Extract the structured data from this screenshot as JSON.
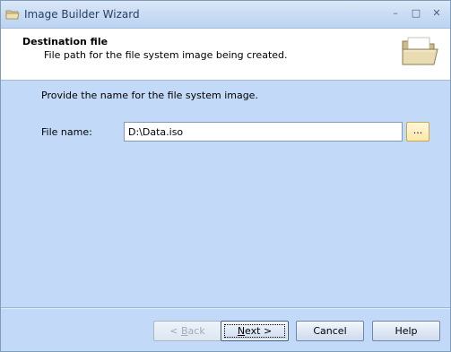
{
  "window": {
    "title": "Image Builder Wizard",
    "controls": {
      "minimize": "–",
      "restore": "□",
      "close": "✕"
    }
  },
  "header": {
    "title": "Destination file",
    "subtitle": "File path for the file system image being created.",
    "icon": "folder-icon"
  },
  "body": {
    "instruction": "Provide the name for the file system image.",
    "file_name_label": "File name:",
    "file_name_value": "D:\\Data.iso",
    "browse_label": "..."
  },
  "buttons": {
    "back": {
      "pre": "< ",
      "accel": "B",
      "post": "ack"
    },
    "next": {
      "accel": "N",
      "post": "ext >"
    },
    "cancel": "Cancel",
    "help": "Help"
  },
  "colors": {
    "background": "#c2daf8",
    "header_background": "#ffffff",
    "titlebar": "#c7dbf4"
  }
}
